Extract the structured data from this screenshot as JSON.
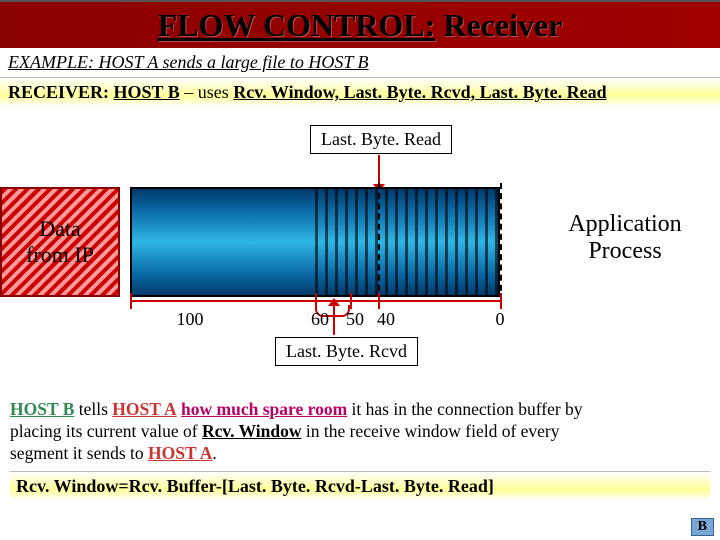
{
  "title": {
    "prefix": "FLOW CONTROL:",
    "suffix": " Receiver"
  },
  "example_line": "EXAMPLE: HOST A sends a large file to HOST B",
  "receiver_line": {
    "prefix": "RECEIVER: ",
    "host": "HOST B",
    "mid": " – uses ",
    "vars": "Rcv. Window,  Last. Byte. Rcvd, Last. Byte. Read"
  },
  "labels": {
    "top": "Last. Byte. Read",
    "bottom": "Last. Byte. Rcvd",
    "left_block_l1": "Data",
    "left_block_l2": "from IP",
    "right_l1": "Application",
    "right_l2": "Process"
  },
  "ticks": {
    "t100": "100",
    "t60": "60",
    "t50": "50",
    "t40": "40",
    "t0": "0"
  },
  "bottom_paragraph": {
    "p1a": " tells ",
    "p1b": " ",
    "spare": "how much spare room",
    "p1c": " it has in the connection buffer by",
    "p2a": "placing its current value of ",
    "rcvw": "Rcv. Window",
    "p2b": " in the receive window field of every",
    "p3a": "segment it sends to ",
    "hostA": "HOST A",
    "hostB": "HOST B",
    "p3b": "."
  },
  "formula": "Rcv. Window=Rcv. Buffer-[Last. Byte. Rcvd-Last. Byte. Read]",
  "corner": "B"
}
